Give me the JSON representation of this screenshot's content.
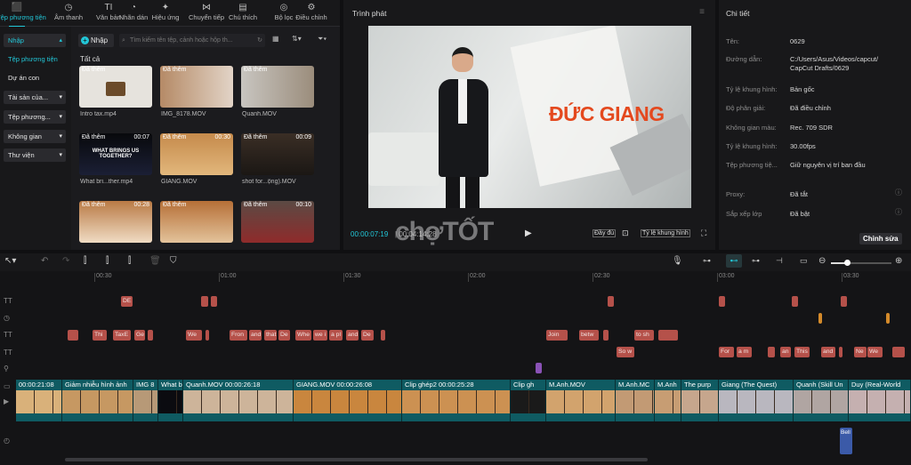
{
  "toolbar": {
    "items": [
      {
        "label": "Tệp phương tiện",
        "icon": "media-icon",
        "active": true
      },
      {
        "label": "Âm thanh",
        "icon": "audio-icon"
      },
      {
        "label": "Văn bản",
        "icon": "text-icon"
      },
      {
        "label": "Nhãn dán",
        "icon": "sticker-icon"
      },
      {
        "label": "Hiệu ứng",
        "icon": "effects-icon"
      },
      {
        "label": "Chuyển tiếp",
        "icon": "transition-icon"
      },
      {
        "label": "Chú thích",
        "icon": "caption-icon"
      },
      {
        "label": "Bộ lọc",
        "icon": "filter-icon"
      },
      {
        "label": "Điều chỉnh",
        "icon": "adjust-icon"
      }
    ]
  },
  "leftnav": {
    "import": "Nhập",
    "media": "Tệp phương tiện",
    "project": "Dự án con",
    "assets": "Tài sản của...",
    "media2": "Tệp phương...",
    "space": "Không gian",
    "library": "Thư viện"
  },
  "media": {
    "import_btn": "Nhập",
    "search_placeholder": "Tìm kiếm tên tệp, cảnh hoặc hộp th...",
    "section": "Tất cả",
    "added": "Đã thêm",
    "items": [
      {
        "name": "Intro tax.mp4",
        "duration": ""
      },
      {
        "name": "IMG_8178.MOV",
        "duration": ""
      },
      {
        "name": "Quanh.MOV",
        "duration": ""
      },
      {
        "name": "What bri...ther.mp4",
        "duration": "00:07"
      },
      {
        "name": "GIANG.MOV",
        "duration": "00:30"
      },
      {
        "name": "shot for...ộng).MOV",
        "duration": "00:09"
      },
      {
        "name": "",
        "duration": "00:28"
      },
      {
        "name": "",
        "duration": ""
      },
      {
        "name": "",
        "duration": "00:10"
      }
    ],
    "thumb_text": "WHAT BRINGS US TOGETHER?"
  },
  "player": {
    "title": "Trình phát",
    "overlay": "ĐỨC GIANG",
    "current": "00:00:07:19",
    "total": "00:04:14:28",
    "full": "Đầy đủ",
    "ratio": "Tỷ lệ khung hình",
    "watermark": "chợTỐT"
  },
  "details": {
    "title": "Chi tiết",
    "rows": [
      {
        "k": "Tên:",
        "v": "0629"
      },
      {
        "k": "Đường dẫn:",
        "v": "C:/Users/Asus/Videos/capcut/ CapCut Drafts/0629"
      },
      {
        "k": "Tỷ lệ khung hình:",
        "v": "Bản gốc"
      },
      {
        "k": "Độ phân giải:",
        "v": "Đã điều chỉnh"
      },
      {
        "k": "Không gian màu:",
        "v": "Rec. 709 SDR"
      },
      {
        "k": "Tỷ lệ khung hình:",
        "v": "30.00fps"
      },
      {
        "k": "Tệp phương tiệ...",
        "v": "Giữ nguyên vị trí ban đầu"
      },
      {
        "k": "Proxy:",
        "v": "Đã tắt"
      },
      {
        "k": "Sắp xếp lớp",
        "v": "Đã bật"
      }
    ],
    "edit": "Chỉnh sửa"
  },
  "timeline": {
    "ruler": [
      "00:30",
      "01:00",
      "01:30",
      "02:00",
      "02:30",
      "03:00",
      "03:30"
    ],
    "text1": [
      "DE",
      "",
      ""
    ],
    "text2": [
      "",
      "Thi",
      "TaxE",
      "Ge",
      "",
      "We",
      "",
      "Fron",
      "and",
      "that",
      "De",
      "Whe",
      "we i",
      "a pl",
      "and",
      "De",
      "",
      "Join",
      "betw",
      "",
      "to sh",
      ""
    ],
    "text3": [
      "So w",
      "For",
      "a m",
      "",
      "an",
      "This",
      "and",
      "",
      "Ne",
      "We",
      ""
    ],
    "video": [
      {
        "label": "00:00:21:08"
      },
      {
        "label": "Giảm nhiễu hình ảnh"
      },
      {
        "label": "IMG 8"
      },
      {
        "label": "What b"
      },
      {
        "label": "Quanh.MOV  00:00:26:18"
      },
      {
        "label": "GIANG.MOV  00:00:26:08"
      },
      {
        "label": "Clip ghép2  00:00:25:28"
      },
      {
        "label": "Clip gh"
      },
      {
        "label": "M.Anh.MOV"
      },
      {
        "label": "M.Anh.MC"
      },
      {
        "label": "M.Anh"
      },
      {
        "label": "The purp"
      },
      {
        "label": "Giang (The Quest)"
      },
      {
        "label": "Quanh (Skill Un"
      },
      {
        "label": "Duy (Real-World"
      }
    ],
    "audio_clip": "Bell"
  }
}
